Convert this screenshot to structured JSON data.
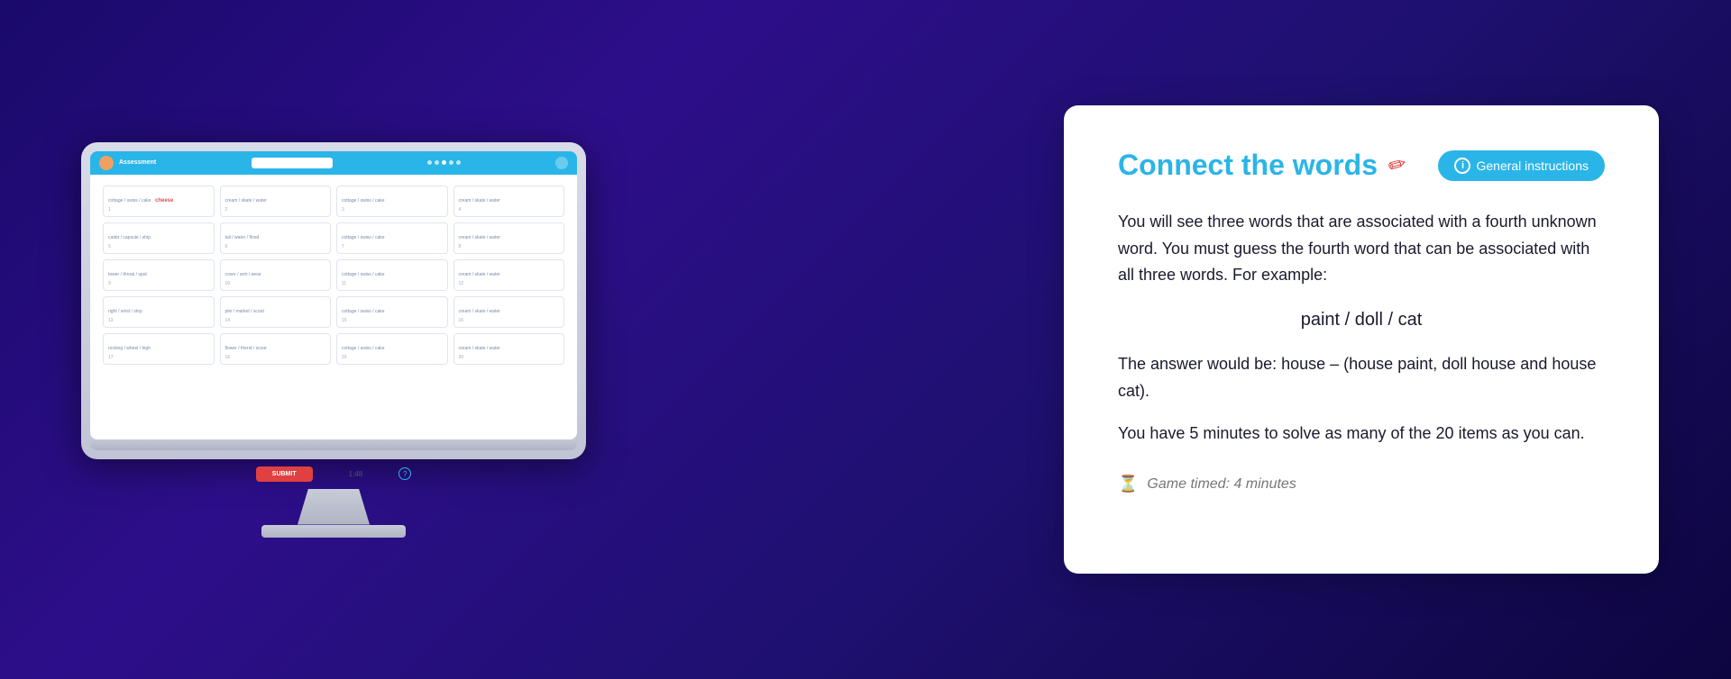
{
  "monitor": {
    "header": {
      "title": "Assessment",
      "search_placeholder": "",
      "dots": [
        false,
        false,
        true,
        false,
        false
      ]
    },
    "grid": {
      "cells": [
        {
          "clue": "cottage / swiss / cake",
          "number": "1",
          "answer": "cheese"
        },
        {
          "clue": "cream / skate / water",
          "number": "2",
          "answer": ""
        },
        {
          "clue": "cottage / swiss / cake",
          "number": "3",
          "answer": ""
        },
        {
          "clue": "cream / skate / water",
          "number": "4",
          "answer": ""
        },
        {
          "clue": "cadet / capsule / ship",
          "number": "5",
          "answer": ""
        },
        {
          "clue": "tail / water / flood",
          "number": "6",
          "answer": ""
        },
        {
          "clue": "cottage / swiss / cake",
          "number": "7",
          "answer": ""
        },
        {
          "clue": "cream / skate / water",
          "number": "8",
          "answer": ""
        },
        {
          "clue": "tower / throat / spot",
          "number": "9",
          "answer": ""
        },
        {
          "clue": "cover / arm / wear",
          "number": "10",
          "answer": ""
        },
        {
          "clue": "cottage / swiss / cake",
          "number": "11",
          "answer": ""
        },
        {
          "clue": "cream / skate / water",
          "number": "12",
          "answer": ""
        },
        {
          "clue": "right / wrist / stop",
          "number": "13",
          "answer": ""
        },
        {
          "clue": "pile / market / scout",
          "number": "14",
          "answer": ""
        },
        {
          "clue": "cottage / swiss / cake",
          "number": "15",
          "answer": ""
        },
        {
          "clue": "cream / skate / water",
          "number": "16",
          "answer": ""
        },
        {
          "clue": "rocking / wheel / high",
          "number": "17",
          "answer": ""
        },
        {
          "clue": "flower / friend / scout",
          "number": "18",
          "answer": ""
        },
        {
          "clue": "cottage / swiss / cake",
          "number": "19",
          "answer": ""
        },
        {
          "clue": "cream / skate / water",
          "number": "20",
          "answer": ""
        }
      ]
    },
    "footer": {
      "submit_label": "SUBMIT",
      "timer": "1:48"
    }
  },
  "instructions": {
    "title": "Connect the words",
    "pencil_icon": "✏",
    "general_instructions_label": "General instructions",
    "info_icon": "i",
    "body_paragraph_1": "You will see three words that are associated with a fourth unknown word. You must guess the fourth word that can be associated with all three words. For example:",
    "example": "paint  /  doll  /  cat",
    "body_paragraph_2": "The answer would be: house – (house paint, doll house and house cat).",
    "body_paragraph_3": "You have 5 minutes to solve as many of the 20 items as you can.",
    "timer_icon": "⏳",
    "timed_label": "Game timed: 4 minutes"
  }
}
